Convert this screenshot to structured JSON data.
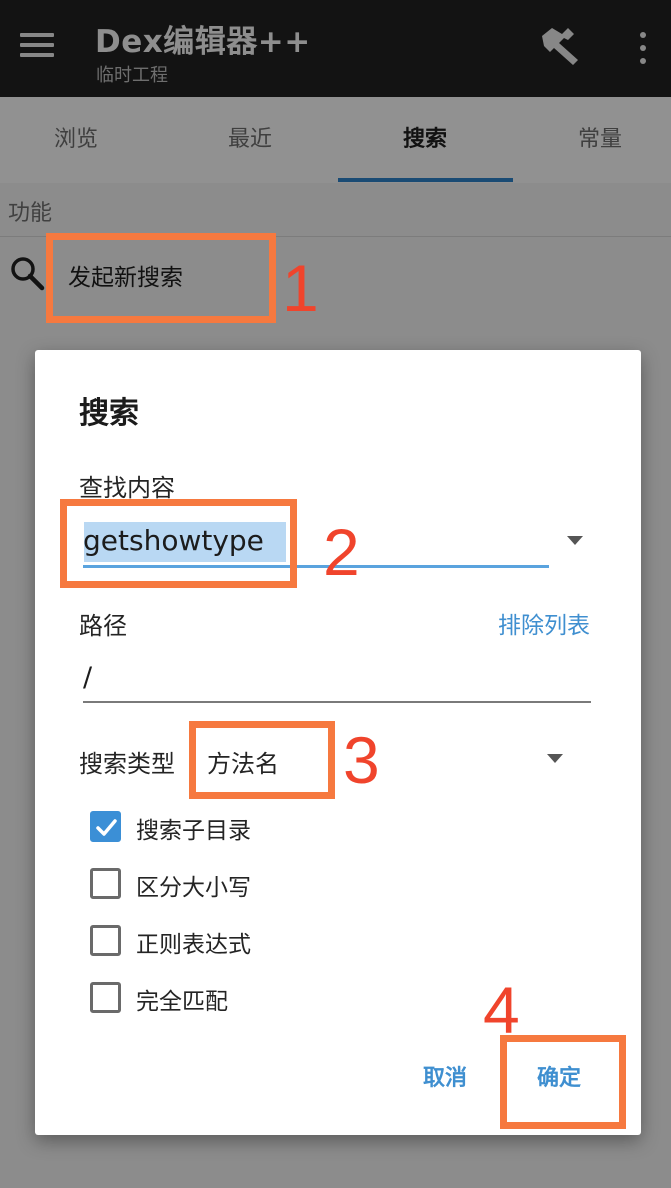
{
  "appbar": {
    "title": "Dex编辑器++",
    "subtitle": "临时工程"
  },
  "tabs": [
    {
      "label": "浏览"
    },
    {
      "label": "最近"
    },
    {
      "label": "搜索"
    },
    {
      "label": "常量"
    }
  ],
  "section": {
    "label": "功能",
    "new_search_label": "发起新搜索"
  },
  "dialog": {
    "title": "搜索",
    "query_label": "查找内容",
    "query_value": "getshowtype",
    "path_label": "路径",
    "exclude_link": "排除列表",
    "path_value": "/",
    "type_label": "搜索类型",
    "type_value": "方法名",
    "options": [
      {
        "label": "搜索子目录",
        "checked": true
      },
      {
        "label": "区分大小写",
        "checked": false
      },
      {
        "label": "正则表达式",
        "checked": false
      },
      {
        "label": "完全匹配",
        "checked": false
      }
    ],
    "cancel_label": "取消",
    "ok_label": "确定"
  },
  "annotations": [
    "1",
    "2",
    "3",
    "4"
  ],
  "colors": {
    "accent": "#3b8fd6",
    "annotation_box": "#f6793f",
    "annotation_number": "#f0442c",
    "appbar": "#212121"
  }
}
